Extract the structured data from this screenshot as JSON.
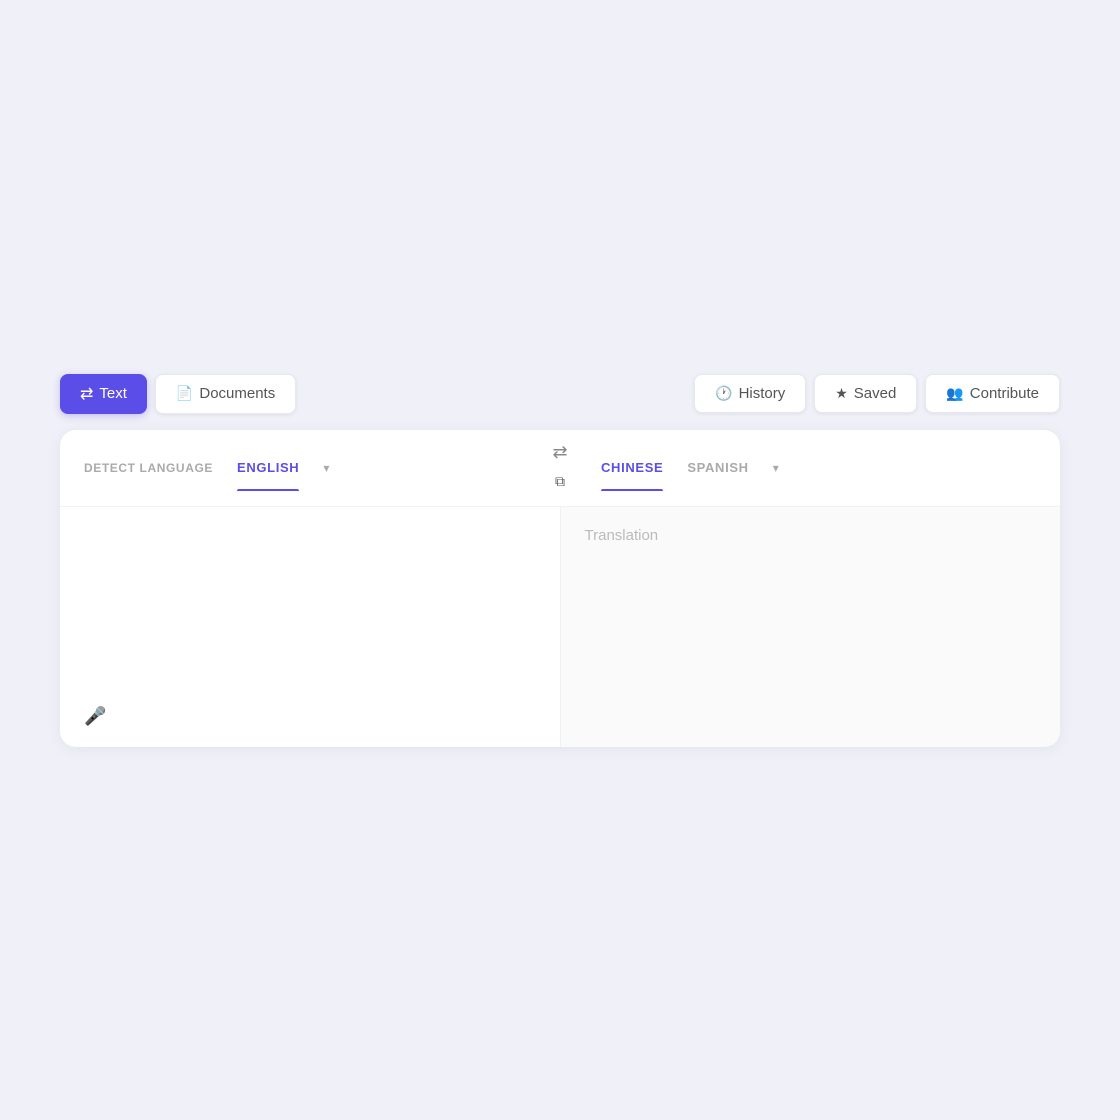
{
  "toolbar": {
    "text_label": "Text",
    "documents_label": "Documents",
    "history_label": "History",
    "saved_label": "Saved",
    "contribute_label": "Contribute"
  },
  "language_bar": {
    "detect_label": "DETECT LANGUAGE",
    "english_label": "ENGLISH",
    "swap_icon": "⇄",
    "chinese_label": "CHINESE",
    "spanish_label": "SPANISH",
    "copy_icon": "⧉"
  },
  "translation": {
    "placeholder": "Translation"
  },
  "colors": {
    "primary": "#5b4de8",
    "background": "#f0f0f8"
  }
}
